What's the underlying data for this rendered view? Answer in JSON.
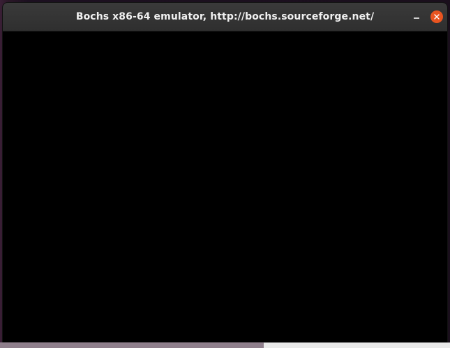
{
  "window": {
    "title": "Bochs x86-64 emulator, http://bochs.sourceforge.net/"
  },
  "controls": {
    "minimize_icon": "minimize-icon",
    "close_icon": "close-icon"
  },
  "colors": {
    "titlebar": "#303030",
    "close_button": "#e95420",
    "display": "#000000"
  }
}
